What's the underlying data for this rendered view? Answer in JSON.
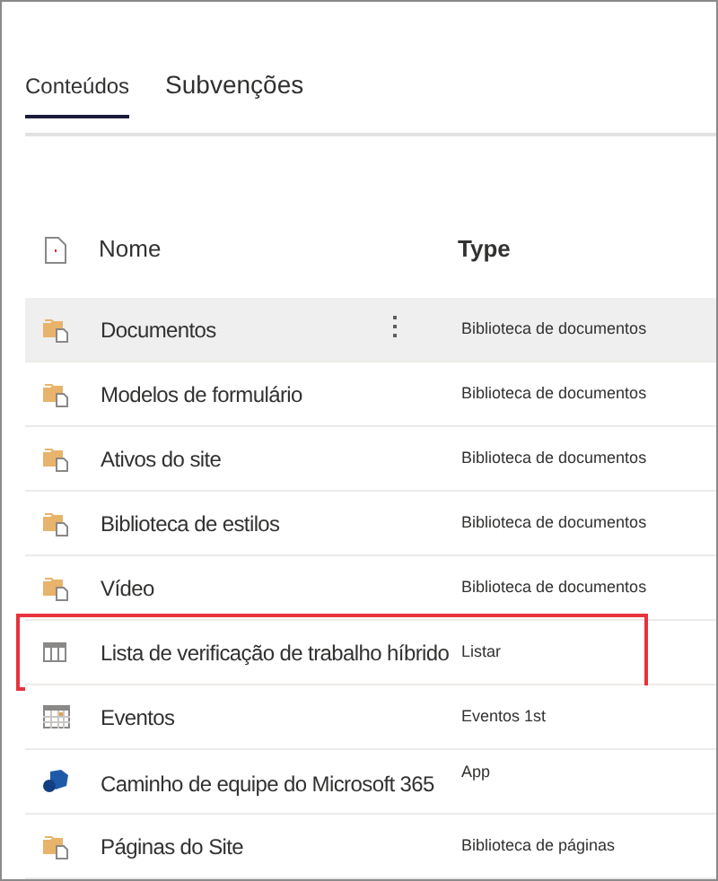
{
  "tabs": [
    {
      "label": "Conteúdos",
      "selected": true
    },
    {
      "label": "Subvenções",
      "selected": false
    }
  ],
  "table": {
    "columns": [
      "Nome",
      "Type"
    ],
    "rows": [
      {
        "kind": "library",
        "name": "Documentos",
        "type": "Biblioteca de documentos",
        "selected": true,
        "highlighted": false
      },
      {
        "kind": "library",
        "name": "Modelos de formulário",
        "type": "Biblioteca de documentos",
        "selected": false,
        "highlighted": false
      },
      {
        "kind": "library",
        "name": "Ativos do site",
        "type": "Biblioteca de documentos",
        "selected": false,
        "highlighted": false
      },
      {
        "kind": "library",
        "name": "Biblioteca de estilos",
        "type": "Biblioteca de documentos",
        "selected": false,
        "highlighted": false
      },
      {
        "kind": "library",
        "name": "Vídeo",
        "type": "Biblioteca de documentos",
        "selected": false,
        "highlighted": false
      },
      {
        "kind": "list",
        "name": "Lista de verificação de trabalho híbrido",
        "type": "Listar",
        "selected": false,
        "highlighted": true
      },
      {
        "kind": "calendar",
        "name": "Eventos",
        "type": "Eventos 1st",
        "selected": false,
        "highlighted": false
      },
      {
        "kind": "app",
        "name": "Caminho de equipe do Microsoft 365",
        "type": "App",
        "selected": false,
        "highlighted": false
      },
      {
        "kind": "library",
        "name": "Páginas do Site",
        "type": "Biblioteca de páginas",
        "selected": false,
        "highlighted": false
      }
    ]
  }
}
